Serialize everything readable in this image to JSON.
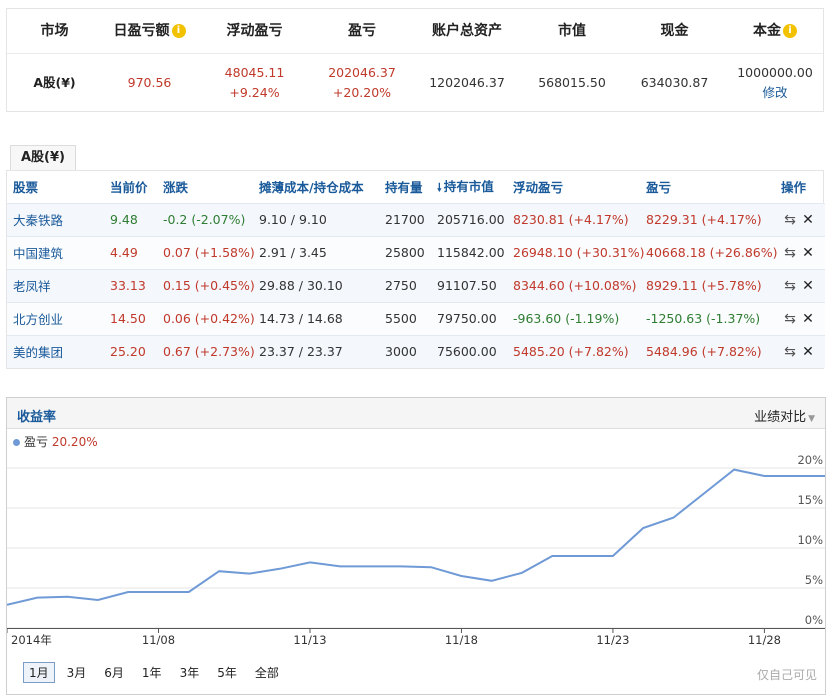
{
  "summary": {
    "headers": [
      "市场",
      "日盈亏额",
      "浮动盈亏",
      "盈亏",
      "账户总资产",
      "市值",
      "现金",
      "本金"
    ],
    "market": "A股(¥)",
    "daily_pl": "970.56",
    "float_pl": "48045.11",
    "float_pl_pct": "+9.24%",
    "total_pl": "202046.37",
    "total_pl_pct": "+20.20%",
    "total_assets": "1202046.37",
    "market_value": "568015.50",
    "cash": "634030.87",
    "principal": "1000000.00",
    "edit_label": "修改",
    "info_icon": "i"
  },
  "holdings": {
    "tab_label": "A股(¥)",
    "columns": [
      "股票",
      "当前价",
      "涨跌",
      "摊薄成本/持仓成本",
      "持有量",
      "持有市值",
      "浮动盈亏",
      "盈亏",
      "操作"
    ],
    "sort_icon": "🠗",
    "transfer_icon": "⇆",
    "close_icon": "✕",
    "rows": [
      {
        "name": "大秦铁路",
        "price": "9.48",
        "change": "-0.2 (-2.07%)",
        "cost": "9.10 / 9.10",
        "qty": "21700",
        "value": "205716.00",
        "float_pl": "8230.81 (+4.17%)",
        "pl": "8229.31 (+4.17%)",
        "change_dir": "down",
        "float_dir": "up",
        "pl_dir": "up"
      },
      {
        "name": "中国建筑",
        "price": "4.49",
        "change": "0.07 (+1.58%)",
        "cost": "2.91 / 3.45",
        "qty": "25800",
        "value": "115842.00",
        "float_pl": "26948.10 (+30.31%)",
        "pl": "40668.18 (+26.86%)",
        "change_dir": "up",
        "float_dir": "up",
        "pl_dir": "up"
      },
      {
        "name": "老凤祥",
        "price": "33.13",
        "change": "0.15 (+0.45%)",
        "cost": "29.88 / 30.10",
        "qty": "2750",
        "value": "91107.50",
        "float_pl": "8344.60 (+10.08%)",
        "pl": "8929.11 (+5.78%)",
        "change_dir": "up",
        "float_dir": "up",
        "pl_dir": "up"
      },
      {
        "name": "北方创业",
        "price": "14.50",
        "change": "0.06 (+0.42%)",
        "cost": "14.73 / 14.68",
        "qty": "5500",
        "value": "79750.00",
        "float_pl": "-963.60 (-1.19%)",
        "pl": "-1250.63 (-1.37%)",
        "change_dir": "up",
        "float_dir": "down",
        "pl_dir": "down"
      },
      {
        "name": "美的集团",
        "price": "25.20",
        "change": "0.67 (+2.73%)",
        "cost": "23.37 / 23.37",
        "qty": "3000",
        "value": "75600.00",
        "float_pl": "5485.20 (+7.82%)",
        "pl": "5484.96 (+7.82%)",
        "change_dir": "up",
        "float_dir": "up",
        "pl_dir": "up"
      }
    ]
  },
  "chart_panel": {
    "title": "收益率",
    "compare_label": "业绩对比",
    "legend_name": "盈亏",
    "legend_value": "20.20%",
    "ranges": [
      "1月",
      "3月",
      "6月",
      "1年",
      "3年",
      "5年",
      "全部"
    ],
    "active_range": "1月",
    "footer_note": "仅自己可见"
  },
  "chart_data": {
    "type": "line",
    "x_tick_labels": [
      "2014年",
      "11/08",
      "11/13",
      "11/18",
      "11/23",
      "11/28"
    ],
    "y_tick_labels": [
      "0%",
      "5%",
      "10%",
      "15%",
      "20%"
    ],
    "ylim": [
      0,
      22
    ],
    "grid": true,
    "colors": {
      "line": "#6f9ad6",
      "grid": "#e6e6e6"
    },
    "series": [
      {
        "name": "盈亏",
        "x": [
          "11/03",
          "11/04",
          "11/05",
          "11/06",
          "11/07",
          "11/08",
          "11/09",
          "11/10",
          "11/11",
          "11/12",
          "11/13",
          "11/14",
          "11/15",
          "11/16",
          "11/17",
          "11/18",
          "11/19",
          "11/20",
          "11/21",
          "11/22",
          "11/23",
          "11/24",
          "11/25",
          "11/26",
          "11/27",
          "11/28",
          "11/29",
          "11/30"
        ],
        "values": [
          2.9,
          3.8,
          3.9,
          3.5,
          4.5,
          4.5,
          4.5,
          7.1,
          6.8,
          7.4,
          8.2,
          7.7,
          7.7,
          7.7,
          7.6,
          6.5,
          5.9,
          6.9,
          9.0,
          9.0,
          9.0,
          12.5,
          13.8,
          16.8,
          19.8,
          19.0,
          19.0,
          19.0
        ]
      }
    ]
  }
}
